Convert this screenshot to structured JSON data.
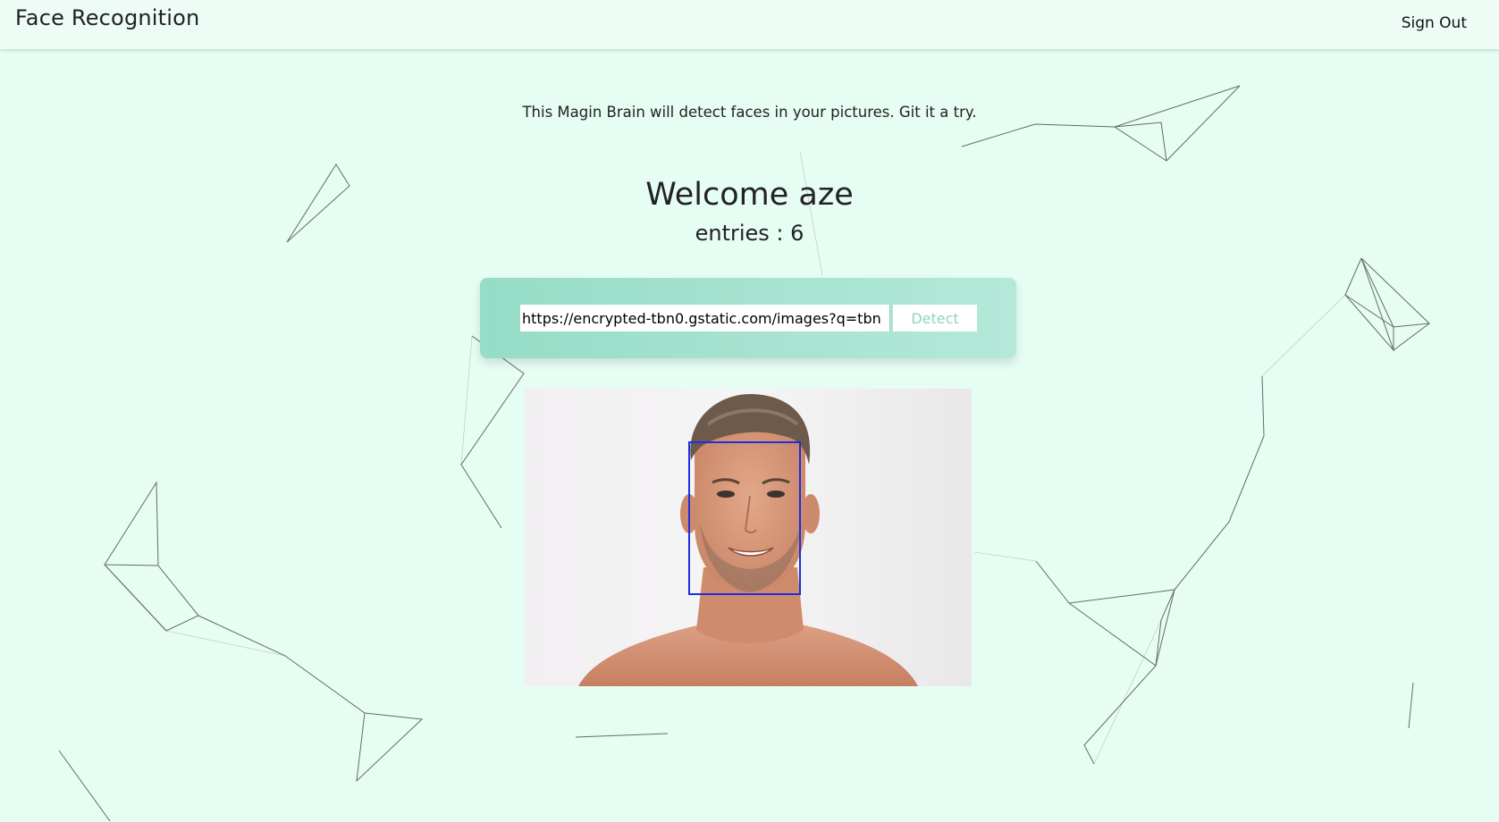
{
  "navbar": {
    "brand": "Face Recognition",
    "signout_label": "Sign Out"
  },
  "main": {
    "tagline": "This Magin Brain will detect faces in your pictures. Git it a try.",
    "welcome": "Welcome aze",
    "entries": "entries : 6"
  },
  "form": {
    "url_value": "https://encrypted-tbn0.gstatic.com/images?q=tbn",
    "detect_label": "Detect"
  },
  "image": {
    "subject": "portrait photo of a smiling man",
    "face_box_color": "#1f2ee0"
  },
  "colors": {
    "background": "#e6fdf3",
    "navbar": "#edfdf6",
    "card_gradient_start": "#96dcc6",
    "card_gradient_end": "#b4e9d9",
    "detect_text": "#8fd4bd"
  }
}
